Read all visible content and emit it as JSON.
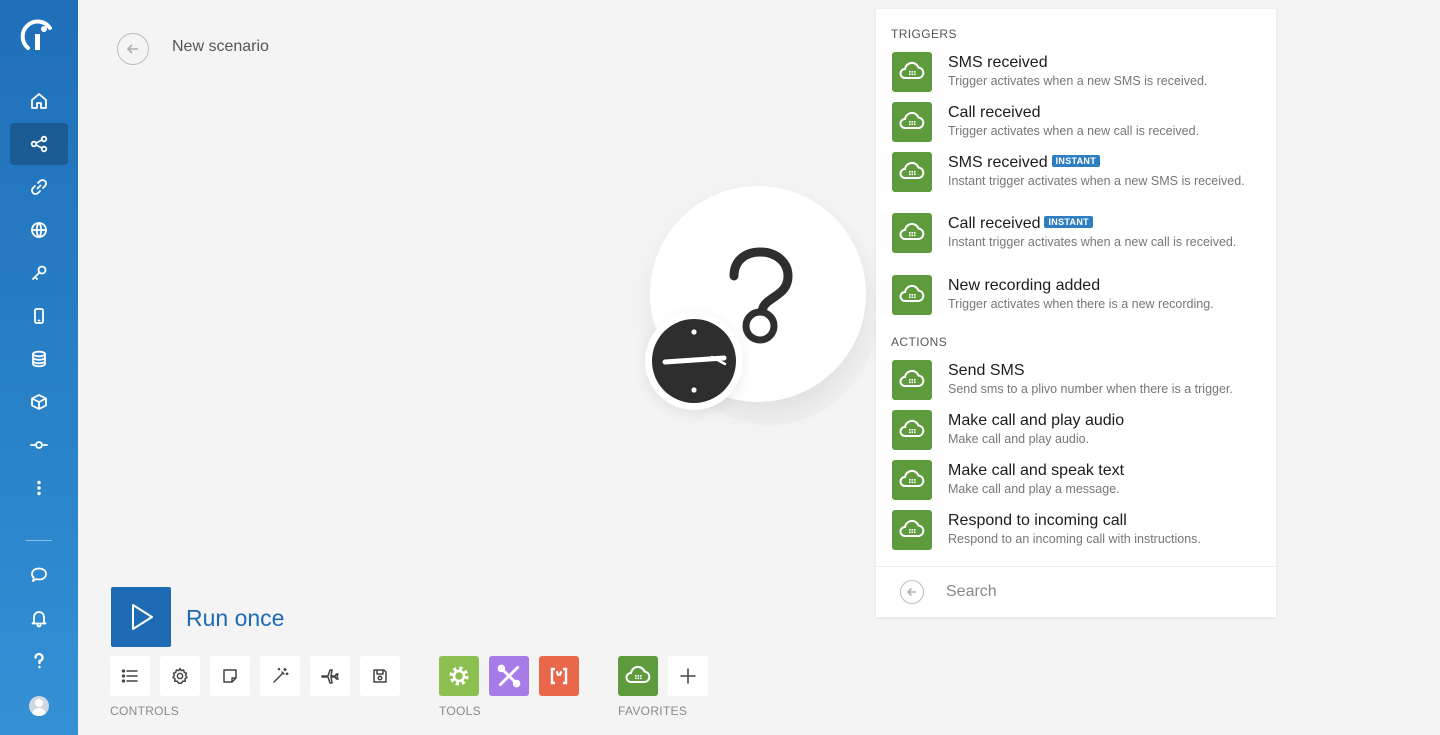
{
  "header": {
    "title": "New scenario"
  },
  "sidebar": {
    "items": [
      {
        "name": "home",
        "icon": "home-icon"
      },
      {
        "name": "scenarios",
        "icon": "share-icon",
        "active": true
      },
      {
        "name": "connections",
        "icon": "link-icon"
      },
      {
        "name": "webhooks",
        "icon": "globe-icon"
      },
      {
        "name": "keys",
        "icon": "key-icon"
      },
      {
        "name": "devices",
        "icon": "mobile-icon"
      },
      {
        "name": "data-stores",
        "icon": "database-icon"
      },
      {
        "name": "data-structures",
        "icon": "cube-icon"
      },
      {
        "name": "templates",
        "icon": "commit-icon"
      },
      {
        "name": "more",
        "icon": "more-icon"
      },
      {
        "name": "chat",
        "icon": "chat-icon"
      },
      {
        "name": "notifications",
        "icon": "bell-icon"
      },
      {
        "name": "help",
        "icon": "help-icon"
      }
    ]
  },
  "controls": {
    "run_label": "Run once",
    "controls_label": "CONTROLS",
    "tools_label": "TOOLS",
    "favorites_label": "FAVORITES"
  },
  "colors": {
    "brand": "#1f6bb3",
    "module_green": "#5d9b3d",
    "tool_gear": "#8cc152",
    "tool_flow": "#a77ce6",
    "tool_text": "#e9674b",
    "instant_badge": "#2f7fc0"
  },
  "panel": {
    "triggers_label": "TRIGGERS",
    "actions_label": "ACTIONS",
    "instant_badge": "INSTANT",
    "search_placeholder": "Search",
    "triggers": [
      {
        "title": "SMS received",
        "desc": "Trigger activates when a new SMS is received.",
        "instant": false
      },
      {
        "title": "Call received",
        "desc": "Trigger activates when a new call is received.",
        "instant": false
      },
      {
        "title": "SMS received",
        "desc": "Instant trigger activates when a new SMS is received.",
        "instant": true
      },
      {
        "title": "Call received",
        "desc": "Instant trigger activates when a new call is received.",
        "instant": true
      },
      {
        "title": "New recording added",
        "desc": "Trigger activates when there is a new recording.",
        "instant": false
      }
    ],
    "actions": [
      {
        "title": "Send SMS",
        "desc": "Send sms to a plivo number when there is a trigger."
      },
      {
        "title": "Make call and play audio",
        "desc": "Make call and play audio."
      },
      {
        "title": "Make call and speak text",
        "desc": "Make call and play a message."
      },
      {
        "title": "Respond to incoming call",
        "desc": "Respond to an incoming call with instructions."
      }
    ]
  }
}
